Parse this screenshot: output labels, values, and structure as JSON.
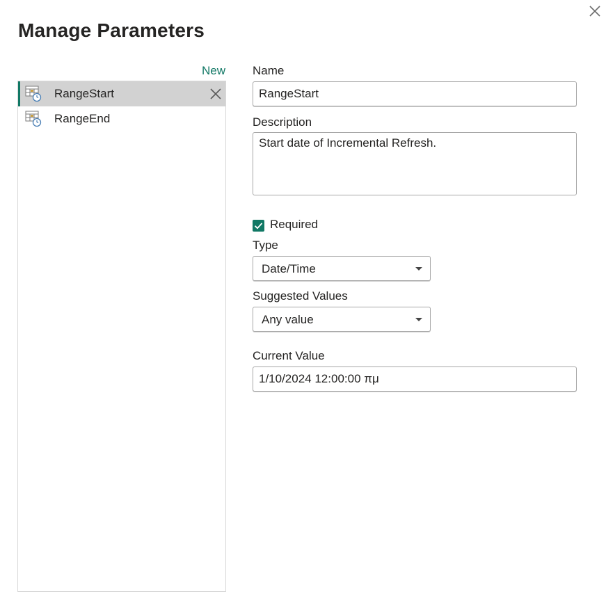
{
  "dialog": {
    "title": "Manage Parameters",
    "close_icon": "close-icon",
    "new_link": "New"
  },
  "parameters": [
    {
      "label": "RangeStart",
      "icon": "parameter-datetime-icon",
      "selected": true
    },
    {
      "label": "RangeEnd",
      "icon": "parameter-datetime-icon",
      "selected": false
    }
  ],
  "form": {
    "name_label": "Name",
    "name_value": "RangeStart",
    "description_label": "Description",
    "description_value": "Start date of Incremental Refresh.",
    "required_label": "Required",
    "required_checked": true,
    "type_label": "Type",
    "type_value": "Date/Time",
    "suggested_label": "Suggested Values",
    "suggested_value": "Any value",
    "current_label": "Current Value",
    "current_value": "1/10/2024 12:00:00 πμ"
  },
  "colors": {
    "accent": "#117865",
    "selected_row": "#d2d2d2"
  }
}
